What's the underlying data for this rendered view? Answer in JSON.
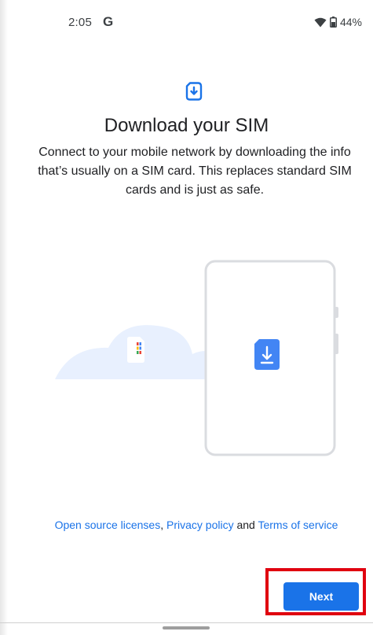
{
  "status_bar": {
    "time": "2:05",
    "g_logo": "G",
    "battery": "44%",
    "icons": [
      "wifi-icon",
      "battery-icon"
    ]
  },
  "header": {
    "icon": "sim-download-icon",
    "title": "Download your SIM",
    "description": "Connect to your mobile network by downloading the info that’s usually on a SIM card. This replaces standard SIM cards and is just as safe."
  },
  "illustration": {
    "icons": [
      "cloud-sim-icon",
      "phone-download-icon"
    ]
  },
  "legal": {
    "link_licenses": "Open source licenses",
    "separator": ", ",
    "link_privacy": "Privacy policy",
    "and_text": " and ",
    "link_terms": "Terms of service"
  },
  "actions": {
    "next_label": "Next"
  },
  "colors": {
    "accent": "#1a73e8",
    "highlight": "#e0000f",
    "cloud": "#e8f0fe",
    "phone_border": "#dadce0"
  }
}
